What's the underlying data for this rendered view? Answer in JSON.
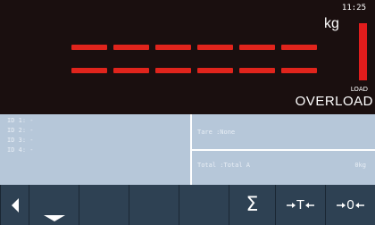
{
  "header": {
    "time": "11:25",
    "unit": "kg",
    "load_label": "LOAD",
    "overload_label": "OVERLOAD"
  },
  "info": {
    "ids": [
      "ID 1: -",
      "ID 2: -",
      "ID 3: -",
      "ID 4: -"
    ],
    "tare": "Tare :None",
    "total": "Total :Total A",
    "total_value": "0kg"
  },
  "toolbar": {
    "buttons": [
      {
        "icon": "arrow-left-icon"
      },
      {
        "icon": "arrow-down-icon"
      },
      {
        "icon": "blank"
      },
      {
        "icon": "blank"
      },
      {
        "icon": "blank"
      },
      {
        "icon": "sigma-icon",
        "label": "Σ"
      },
      {
        "icon": "tare-icon",
        "label": "T"
      },
      {
        "icon": "zero-icon",
        "label": "0"
      }
    ]
  }
}
